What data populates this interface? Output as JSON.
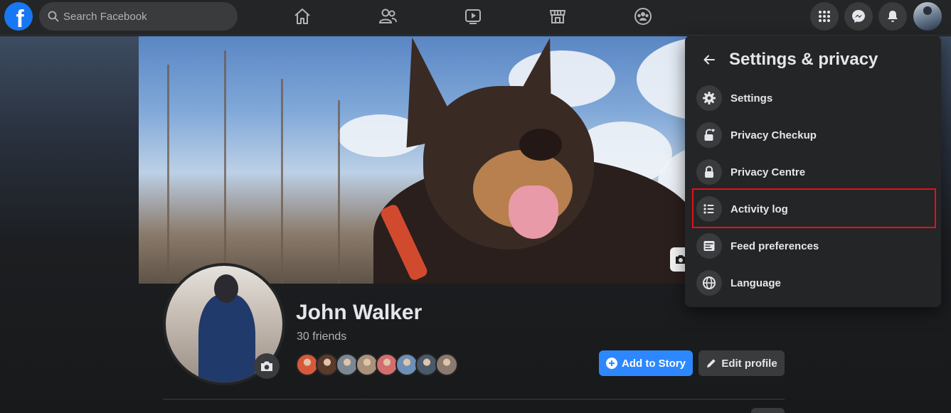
{
  "topbar": {
    "logo_letter": "f",
    "search_placeholder": "Search Facebook"
  },
  "profile": {
    "name": "John Walker",
    "friends_count": "30 friends",
    "add_story_label": "Add to Story",
    "edit_profile_label": "Edit profile",
    "friend_avatar_colors": [
      "#d65a3a",
      "#5a3a2a",
      "#7c8794",
      "#a9927c",
      "#d46d6d",
      "#6e8fb8",
      "#4a5a6a",
      "#8a7a70"
    ]
  },
  "menu": {
    "title": "Settings & privacy",
    "items": [
      {
        "label": "Settings",
        "icon": "gear-icon"
      },
      {
        "label": "Privacy Checkup",
        "icon": "lock-heart-icon"
      },
      {
        "label": "Privacy Centre",
        "icon": "lock-icon"
      },
      {
        "label": "Activity log",
        "icon": "list-icon"
      },
      {
        "label": "Feed preferences",
        "icon": "feed-icon"
      },
      {
        "label": "Language",
        "icon": "globe-icon"
      }
    ],
    "highlighted_item": "Activity log",
    "highlight_color": "#e5101b"
  },
  "colors": {
    "brand": "#1877f2",
    "primary_button": "#2d88ff",
    "surface": "#242526",
    "background": "#18191a"
  }
}
